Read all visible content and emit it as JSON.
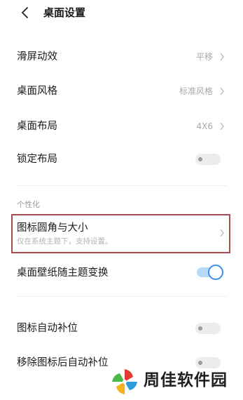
{
  "header": {
    "title": "桌面设置",
    "back_icon": "chevron-left-icon"
  },
  "rows": {
    "scroll_effect": {
      "label": "滑屏动效",
      "value": "平移"
    },
    "desktop_style": {
      "label": "桌面风格",
      "value": "标准风格"
    },
    "desktop_layout": {
      "label": "桌面布局",
      "value": "4X6"
    },
    "lock_layout": {
      "label": "锁定布局",
      "toggle": false
    }
  },
  "personalization": {
    "section_label": "个性化",
    "icon_corner": {
      "label": "图标圆角与大小",
      "sublabel": "仅在系统主题下，支持设置。"
    },
    "wallpaper_follow": {
      "label": "桌面壁纸随主题变换",
      "toggle": true
    }
  },
  "more": {
    "auto_fill": {
      "label": "图标自动补位",
      "toggle": false
    },
    "remove_fill": {
      "label": "移除图标后自动补位",
      "toggle": false
    }
  },
  "watermark": {
    "text": "周佳软件园"
  },
  "colors": {
    "highlight": "#a24d52",
    "toggle_on": "#3b8ff0"
  }
}
